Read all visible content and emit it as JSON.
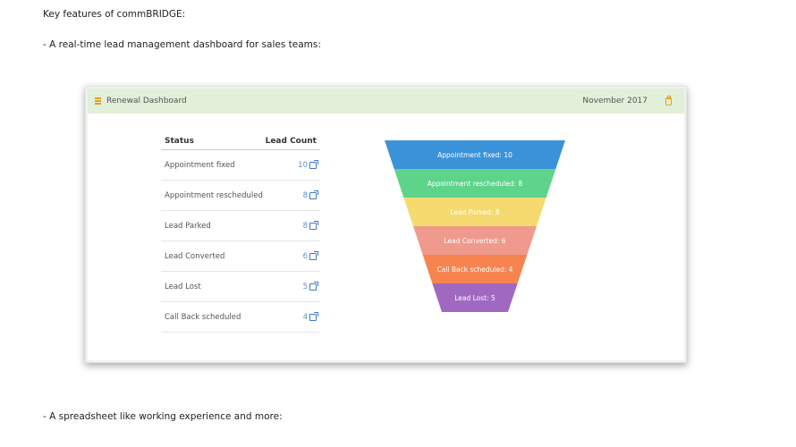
{
  "intro": "Key features of commBRIDGE:",
  "bullet1": "-  A real-time lead management dashboard for sales teams:",
  "bullet2": "-  A spreadsheet like working experience and more:",
  "dashboard": {
    "title": "Renewal Dashboard",
    "month": "November 2017",
    "accent": "#e0a21b",
    "header_bg": "#e2efd9",
    "columns": [
      "Status",
      "Lead Count"
    ],
    "rows": [
      {
        "status": "Appointment fixed",
        "count": "10"
      },
      {
        "status": "Appointment rescheduled",
        "count": "8"
      },
      {
        "status": "Lead Parked",
        "count": "8"
      },
      {
        "status": "Lead Converted",
        "count": "6"
      },
      {
        "status": "Lead Lost",
        "count": "5"
      },
      {
        "status": "Call Back scheduled",
        "count": "4"
      }
    ]
  },
  "chart_data": {
    "type": "funnel",
    "categories": [
      "Appointment fixed",
      "Appointment rescheduled",
      "Lead Parked",
      "Lead Converted",
      "Call Back scheduled",
      "Lead Lost"
    ],
    "values": [
      10,
      8,
      8,
      6,
      4,
      5
    ],
    "labels": [
      "Appointment fixed: 10",
      "Appointment rescheduled: 8",
      "Lead Parked: 8",
      "Lead Converted: 6",
      "Call Back scheduled: 4",
      "Lead Lost: 5"
    ],
    "colors": [
      "#3a93d9",
      "#5dd48a",
      "#f4da6f",
      "#ef9a8c",
      "#f7834f",
      "#a168c2"
    ]
  }
}
